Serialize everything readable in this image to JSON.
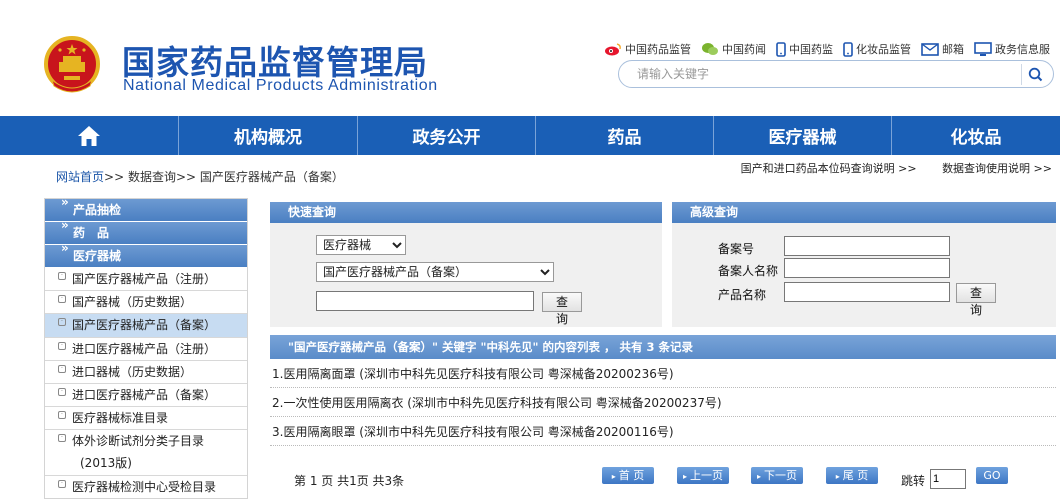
{
  "header": {
    "title_cn": "国家药品监督管理局",
    "title_en": "National Medical Products Administration",
    "top_links": [
      {
        "label": "中国药品监管",
        "icon": "weibo-icon"
      },
      {
        "label": "中国药闻",
        "icon": "wechat-icon"
      },
      {
        "label": "中国药监",
        "icon": "mobile-icon"
      },
      {
        "label": "化妆品监管",
        "icon": "mobile-icon"
      },
      {
        "label": "邮箱",
        "icon": "mail-icon"
      },
      {
        "label": "政务信息服",
        "icon": "monitor-icon"
      }
    ],
    "search_placeholder": "请输入关键字"
  },
  "nav": {
    "items": [
      "机构概况",
      "政务公开",
      "药品",
      "医疗器械",
      "化妆品"
    ]
  },
  "breadcrumb": {
    "home": "网站首页",
    "sep": ">>",
    "level2": "数据查询",
    "current": "国产医疗器械产品（备案）"
  },
  "help_links": [
    "国产和进口药品本位码查询说明 >>",
    "数据查询使用说明 >>"
  ],
  "sidebar": {
    "headers": [
      "产品抽检",
      "药　品",
      "医疗器械"
    ],
    "items": [
      {
        "label": "国产医疗器械产品（注册）"
      },
      {
        "label": "国产器械（历史数据）"
      },
      {
        "label": "国产医疗器械产品（备案）",
        "active": true
      },
      {
        "label": "进口医疗器械产品（注册）"
      },
      {
        "label": "进口器械（历史数据）"
      },
      {
        "label": "进口医疗器械产品（备案）"
      },
      {
        "label": "医疗器械标准目录"
      },
      {
        "label": "体外诊断试剂分类子目录",
        "label2": "(2013版)"
      },
      {
        "label": "医疗器械检测中心受检目录"
      }
    ]
  },
  "quick_query": {
    "title": "快速查询",
    "category_selected": "医疗器械",
    "database_selected": "国产医疗器械产品（备案）",
    "keyword_value": "",
    "search_button": "查 询"
  },
  "advanced_query": {
    "title": "高级查询",
    "fields": [
      "备案号",
      "备案人名称",
      "产品名称"
    ],
    "search_button": "查 询"
  },
  "results": {
    "header": "\"国产医疗器械产品（备案）\" 关键字 \"中科先见\" 的内容列表 ， 共有 3 条记录",
    "rows": [
      "1.医用隔离面罩 (深圳市中科先见医疗科技有限公司 粤深械备20200236号)",
      "2.一次性使用医用隔离衣 (深圳市中科先见医疗科技有限公司 粤深械备20200237号)",
      "3.医用隔离眼罩 (深圳市中科先见医疗科技有限公司 粤深械备20200116号)"
    ]
  },
  "pager": {
    "summary": "第 1 页 共1页 共3条",
    "first": "首 页",
    "prev": "上一页",
    "next": "下一页",
    "last": "尾 页",
    "jump_label": "跳转",
    "jump_value": "1",
    "go": "GO"
  },
  "colors": {
    "brand_blue": "#1d55b0",
    "nav_blue": "#1a5fb6",
    "panel_head_blue": "#5a8cc9",
    "active_item": "#c7dcf2"
  }
}
